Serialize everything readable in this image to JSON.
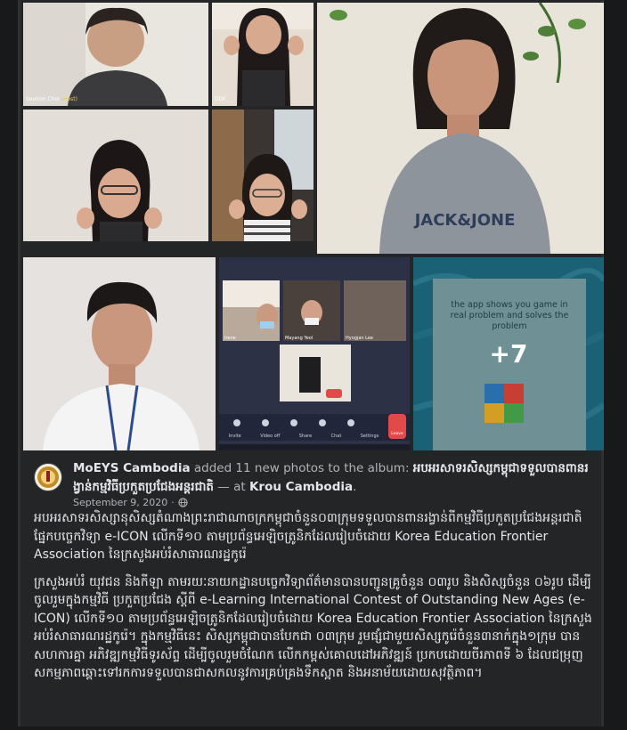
{
  "photos": {
    "host_name": "Soonim Choi",
    "host_tag": "(Host)",
    "participant_2": "DDF",
    "grid_names": [
      "Irene",
      "Mayang Yeol",
      "Hyogjan Lee"
    ],
    "share_caption": "the app shows you game in real problem and solves the problem",
    "more_count": "+7",
    "toolbar": [
      "Invite",
      "Video off",
      "Share",
      "Chat",
      "Settings"
    ],
    "leave": "Leave",
    "shirt_text": "JACK&JONE"
  },
  "post": {
    "page_name": "MoEYS Cambodia",
    "action_text": " added 11 new photos to the album: ",
    "album_title": "អបអរសាទរសិស្សកម្ពុជាទទួលបានពានរង្វាន់កម្មវិធីប្រកួតប្រជែងអន្តរជាតិ",
    "at_text": " — at ",
    "location": "Krou Cambodia",
    "location_suffix": ".",
    "date": "September 9, 2020",
    "paragraph_1": "អបអរសាទរសិស្សានុសិស្សតំណាងព្រះរាជាណាចក្រកម្ពុជាចំនួន០៣ក្រុមទទួលបានពានរង្វាន់ពីកម្មវិធីប្រកួតប្រជែងអន្តរជាតិផ្នែកបច្ចេកវិទ្យា e-ICON លើកទី១០ តាមប្រព័ន្ធអេឡិចត្រូនិកដែលរៀបចំដោយ Korea Education Frontier Association នៃក្រសួងអប់រំសាធារណរដ្ឋកូរ៉េ",
    "paragraph_2": "ក្រសួងអប់រំ យុវជន និងកីឡា តាមរយៈនាយកដ្ឋានបច្ចេកវិទ្យាព័ត៌មានបានបញ្ជូនគ្រូចំនួន ០៣រូប និងសិស្សចំនួន ០៦រូប ដើម្បីចូលរួមក្នុងកម្មវិធី ប្រកួតប្រជែង ស្ដីពី e-Learning International Contest of Outstanding New Ages (e-ICON) លើកទី១០ តាមប្រព័ន្ធអេឡិចត្រូនិកដែលរៀបចំដោយ Korea Education Frontier Association នៃក្រសួងអប់រំសាធារណរដ្ឋកូរ៉េ។ ក្នុងកម្មវិធីនេះ សិស្សកម្ពុជាបានបែកជា ០៣ក្រុម រួមផ្សំជាមួយសិស្សកូរ៉េចំនួន៣នាក់ក្នុង១ក្រុម បានសហការគ្នា អភិវឌ្ឍកម្មវិធីទូរស័ព្ទ ដើម្បីចូលរួមចំណែក លើកកម្ពស់គោលដៅអភិវឌ្ឍន៍ ប្រកបដោយចីរភាពទី ៦ ដែលជម្រុញសកម្មភាពឆ្ពោះទៅរកការទទួលបានជាសកលនូវការគ្រប់គ្រងទឹកស្អាត និងអនាម័យដោយសុវត្ថិភាព។"
  },
  "colors": {
    "background": "#18191a",
    "card": "#242526",
    "text_primary": "#e4e6eb",
    "text_secondary": "#b0b3b8",
    "water": "#1f6f86",
    "app_card": "#7fa6ab"
  },
  "icons": [
    "globe-icon",
    "moeys-emblem-icon",
    "puzzle-icon",
    "leave-icon"
  ]
}
